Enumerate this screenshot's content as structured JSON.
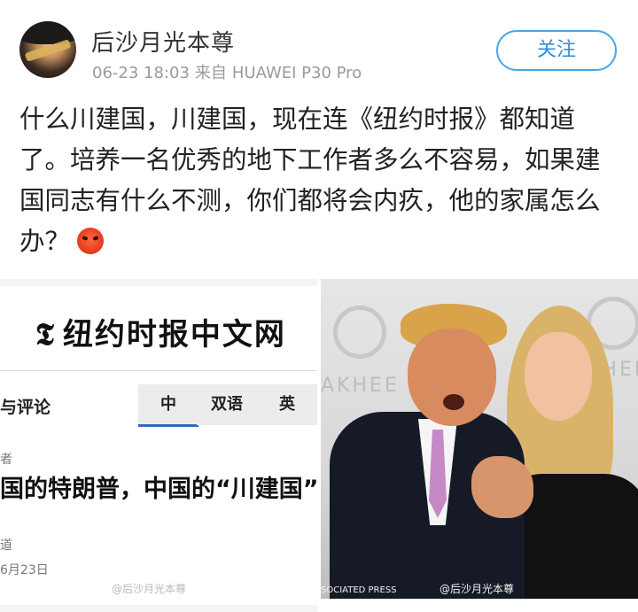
{
  "post": {
    "username": "后沙月光本尊",
    "timestamp": "06-23 18:03",
    "source_prefix": "来自",
    "device": "HUAWEI P30 Pro",
    "follow_label": "关注",
    "text": "什么川建国，川建国，现在连《纽约时报》都知道了。培养一名优秀的地下工作者多么不容易，如果建国同志有什么不测，你们都将会内疚，他的家属怎么办？",
    "emoji_icon": "angry-face-icon"
  },
  "image_left": {
    "logo_mark": "𝕿",
    "logo_text": "纽约时报中文网",
    "section": "与评论",
    "lang_tabs": [
      "中",
      "双语",
      "英"
    ],
    "author_fragment": "者",
    "headline": "国的特朗普，中国的“川建国”",
    "byline_fragment": "道",
    "date_fragment": "6月23日",
    "watermark": "@后沙月光本尊"
  },
  "image_right": {
    "backdrop_text": "AKHEE",
    "backdrop_text_right": "KHEE",
    "credit": "SOCIATED PRESS",
    "watermark": "@后沙月光本尊"
  },
  "colors": {
    "follow_blue": "#2e8fdd",
    "follow_border": "#4aa7e8",
    "meta_gray": "#9a9a9a",
    "tab_active": "#2f6db3"
  }
}
